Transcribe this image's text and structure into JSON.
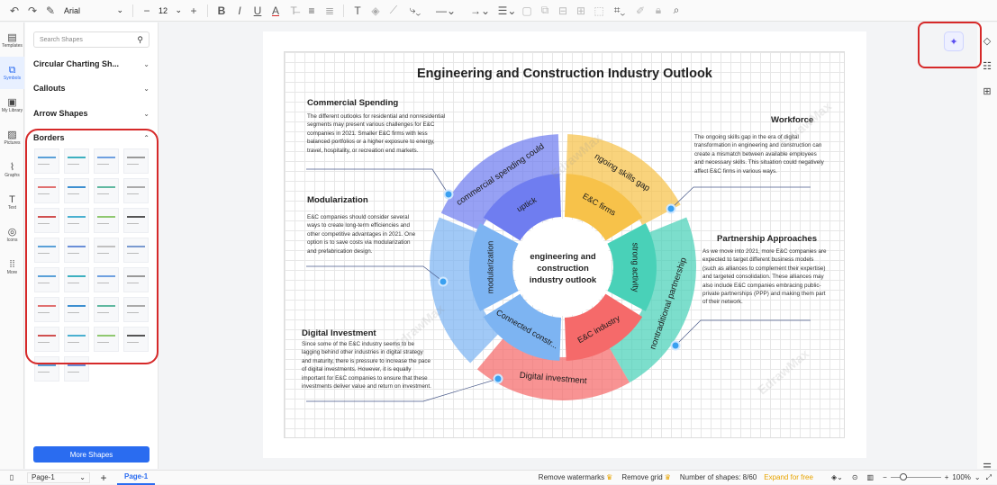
{
  "toolbar": {
    "font": "Arial",
    "font_size": "12"
  },
  "left_nav": [
    {
      "label": "Templates",
      "icon": "templates-icon"
    },
    {
      "label": "Symbols",
      "icon": "symbols-icon"
    },
    {
      "label": "My Library",
      "icon": "library-icon"
    },
    {
      "label": "Pictures",
      "icon": "pictures-icon"
    },
    {
      "label": "Graphs",
      "icon": "graphs-icon"
    },
    {
      "label": "Text",
      "icon": "text-icon"
    },
    {
      "label": "Icons",
      "icon": "icons-icon"
    },
    {
      "label": "More",
      "icon": "more-icon"
    }
  ],
  "panel": {
    "search_placeholder": "Search Shapes",
    "categories": [
      {
        "label": "Circular Charting Sh...",
        "state": "collapsed"
      },
      {
        "label": "Callouts",
        "state": "collapsed"
      },
      {
        "label": "Arrow Shapes",
        "state": "collapsed"
      },
      {
        "label": "Borders",
        "state": "expanded"
      }
    ],
    "more_shapes": "More Shapes"
  },
  "diagram": {
    "title": "Engineering and Construction Industry Outlook",
    "center": "engineering and construction industry outlook",
    "inner_labels": [
      "uptick",
      "E&C firms",
      "strong activity",
      "E&C industry",
      "Connected constr...",
      "modularization"
    ],
    "outer_labels": [
      "commercial spending could",
      "ngoing skills gap",
      "nontraditional partnership",
      "Digital investment"
    ],
    "sections": [
      {
        "heading": "Commercial Spending",
        "text": "The different outlooks for residential and nonresidential segments may present various challenges for E&C companies in 2021. Smaller E&C firms with less balanced portfolios or a higher exposure to energy, travel, hospitality, or recreation end markets."
      },
      {
        "heading": "Workforce",
        "text": "The ongoing skills gap in the era of digital transformation in engineering and construction can create a mismatch between available employees and necessary skills. This situation could negatively affect E&C firms in various ways."
      },
      {
        "heading": "Modularization",
        "text": "E&C companies should consider several ways to create long-term efficiencies and other competitive advantages in 2021. One option is to save costs via modularization and prefabrication design."
      },
      {
        "heading": "Partnership Approaches",
        "text": "As we move into 2021, more E&C companies are expected to target different business models (such as alliances to complement their expertise) and targeted consolidation. These alliances may also include E&C companies embracing public-private partnerships (PPP) and making them part of their network."
      },
      {
        "heading": "Digital Investment",
        "text": "Since some of the E&C industry seems to be lagging behind other industries in digital strategy and maturity, there is pressure to increase the pace of digital investments. However, it is equally important for E&C companies to ensure that these investments deliver value and return on investment."
      }
    ],
    "watermark": "EdrawMax"
  },
  "status": {
    "page_select": "Page-1",
    "page_tab": "Page-1",
    "remove_watermarks": "Remove watermarks",
    "remove_grid": "Remove grid",
    "shape_count": "Number of shapes: 8/60",
    "expand": "Expand for free",
    "zoom": "100%"
  },
  "colors": {
    "accent": "#2a6cf0",
    "highlight_box": "#d62929",
    "seg_blue": "#6f7df0",
    "seg_orange": "#f7c24a",
    "seg_teal": "#49d1b8",
    "seg_red": "#f56a6a",
    "seg_lightblue": "#7db4f2"
  }
}
